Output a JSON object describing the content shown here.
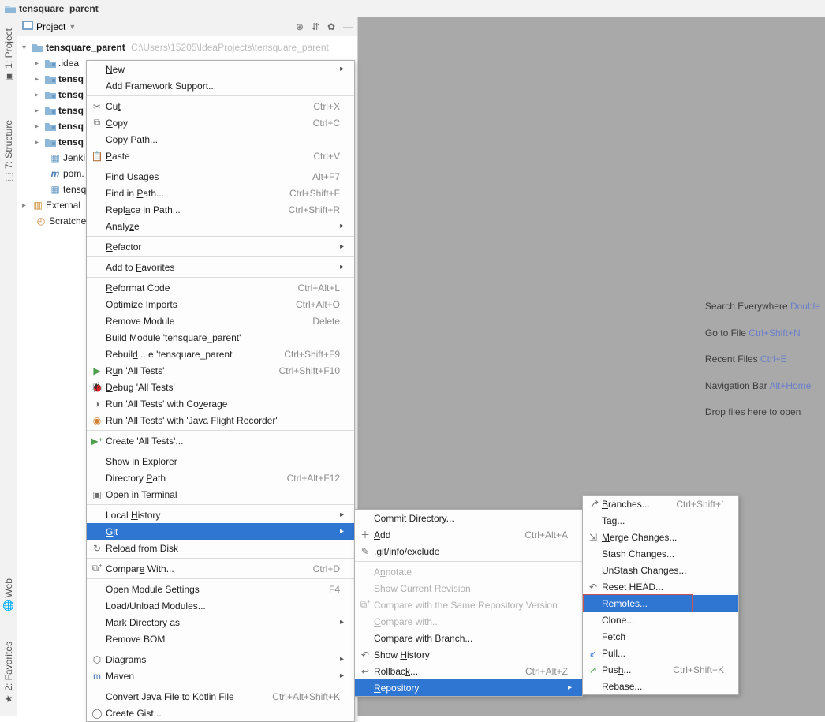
{
  "window": {
    "title": "tensquare_parent"
  },
  "leftTabs": {
    "project": "1: Project",
    "structure": "7: Structure",
    "web": "Web",
    "favorites": "2: Favorites"
  },
  "projectHeader": {
    "label": "Project",
    "icons": {
      "target": "⊕",
      "collapse": "⇵",
      "gear": "✿",
      "hide": "—"
    }
  },
  "tree": {
    "root": {
      "name": "tensquare_parent",
      "path": "C:\\Users\\15205\\IdeaProjects\\tensquare_parent"
    },
    "items": [
      {
        "name": ".idea"
      },
      {
        "name": "tensq"
      },
      {
        "name": "tensq"
      },
      {
        "name": "tensq"
      },
      {
        "name": "tensq"
      },
      {
        "name": "tensq"
      },
      {
        "name": "Jenki"
      },
      {
        "name": "pom."
      },
      {
        "name": "tensq"
      }
    ],
    "external": "External",
    "scratches": "Scratche"
  },
  "tips": [
    {
      "pre": "Search Everywhere ",
      "key": "Double"
    },
    {
      "pre": "Go to File ",
      "key": "Ctrl+Shift+N"
    },
    {
      "pre": "Recent Files ",
      "key": "Ctrl+E"
    },
    {
      "pre": "Navigation Bar ",
      "key": "Alt+Home"
    },
    {
      "pre": "Drop files here to open",
      "key": ""
    }
  ],
  "menu1": [
    {
      "type": "item",
      "u": "N",
      "label": "ew",
      "arrow": true
    },
    {
      "type": "item",
      "label": "Add Framework Support..."
    },
    {
      "type": "sep"
    },
    {
      "type": "item",
      "icon": "✂",
      "label": "Cu",
      "u": "t",
      "after": "",
      "sc": "Ctrl+X"
    },
    {
      "type": "item",
      "icon": "⧉",
      "u": "C",
      "label": "opy",
      "sc": "Ctrl+C"
    },
    {
      "type": "item",
      "label": "Copy Path..."
    },
    {
      "type": "item",
      "icon": "📋",
      "u": "P",
      "label": "aste",
      "sc": "Ctrl+V"
    },
    {
      "type": "sep"
    },
    {
      "type": "item",
      "label": "Find ",
      "u": "U",
      "after": "sages",
      "sc": "Alt+F7"
    },
    {
      "type": "item",
      "label": "Find in ",
      "u": "P",
      "after": "ath...",
      "sc": "Ctrl+Shift+F"
    },
    {
      "type": "item",
      "label": "Repl",
      "u": "a",
      "after": "ce in Path...",
      "sc": "Ctrl+Shift+R"
    },
    {
      "type": "item",
      "label": "Analy",
      "u": "z",
      "after": "e",
      "arrow": true
    },
    {
      "type": "sep"
    },
    {
      "type": "item",
      "u": "R",
      "label": "efactor",
      "arrow": true
    },
    {
      "type": "sep"
    },
    {
      "type": "item",
      "label": "Add to ",
      "u": "F",
      "after": "avorites",
      "arrow": true
    },
    {
      "type": "sep"
    },
    {
      "type": "item",
      "u": "R",
      "label": "eformat Code",
      "sc": "Ctrl+Alt+L"
    },
    {
      "type": "item",
      "label": "Optimi",
      "u": "z",
      "after": "e Imports",
      "sc": "Ctrl+Alt+O"
    },
    {
      "type": "item",
      "label": "Remove Module",
      "sc": "Delete"
    },
    {
      "type": "item",
      "label": "Build ",
      "u": "M",
      "after": "odule 'tensquare_parent'"
    },
    {
      "type": "item",
      "label": "Rebuil",
      "u": "d",
      "after": " ...e 'tensquare_parent'",
      "sc": "Ctrl+Shift+F9"
    },
    {
      "type": "item",
      "icon": "▶",
      "iconColor": "#4f9e4f",
      "label": "R",
      "u": "u",
      "after": "n 'All Tests'",
      "sc": "Ctrl+Shift+F10"
    },
    {
      "type": "item",
      "icon": "🐞",
      "iconColor": "#4f9e4f",
      "u": "D",
      "label": "ebug 'All Tests'"
    },
    {
      "type": "item",
      "icon": "◑",
      "label": "Run 'All Tests' with Co",
      "u": "v",
      "after": "erage"
    },
    {
      "type": "item",
      "icon": "◉",
      "iconColor": "#d08030",
      "label": "Run 'All Tests' with 'Java Flight Recorder'"
    },
    {
      "type": "sep"
    },
    {
      "type": "item",
      "icon": "▶⁺",
      "iconColor": "#4f9e4f",
      "label": "Create 'All Tests'..."
    },
    {
      "type": "sep"
    },
    {
      "type": "item",
      "label": "Show in Explorer"
    },
    {
      "type": "item",
      "label": "Directory ",
      "u": "P",
      "after": "ath",
      "sc": "Ctrl+Alt+F12"
    },
    {
      "type": "item",
      "icon": "▣",
      "label": "Open in Terminal"
    },
    {
      "type": "sep"
    },
    {
      "type": "item",
      "label": "Local ",
      "u": "H",
      "after": "istory",
      "arrow": true
    },
    {
      "type": "item",
      "selected": true,
      "u": "G",
      "label": "it",
      "arrow": true
    },
    {
      "type": "item",
      "icon": "↻",
      "label": "Reload from Disk"
    },
    {
      "type": "sep"
    },
    {
      "type": "item",
      "icon": "⧉⁺",
      "label": "Compar",
      "u": "e",
      "after": " With...",
      "sc": "Ctrl+D"
    },
    {
      "type": "sep"
    },
    {
      "type": "item",
      "label": "Open Module Settings",
      "sc": "F4"
    },
    {
      "type": "item",
      "label": "Load/Unload Modules..."
    },
    {
      "type": "item",
      "label": "Mark Directory as",
      "arrow": true
    },
    {
      "type": "item",
      "label": "Remove BOM"
    },
    {
      "type": "sep"
    },
    {
      "type": "item",
      "icon": "⬡",
      "label": "Diagrams",
      "arrow": true
    },
    {
      "type": "item",
      "icon": "m",
      "iconColor": "#4a7ab5",
      "label": "Maven",
      "arrow": true
    },
    {
      "type": "sep"
    },
    {
      "type": "item",
      "label": "Convert Java File to Kotlin File",
      "sc": "Ctrl+Alt+Shift+K"
    },
    {
      "type": "item",
      "icon": "◯",
      "label": "Create Gist..."
    }
  ],
  "menu2": [
    {
      "type": "item",
      "label": "Commit Directory..."
    },
    {
      "type": "item",
      "icon": "＋",
      "u": "A",
      "label": "dd",
      "sc": "Ctrl+Alt+A"
    },
    {
      "type": "item",
      "icon": "✎",
      "label": ".git/info/exclude"
    },
    {
      "type": "sep"
    },
    {
      "type": "item",
      "disabled": true,
      "label": "A",
      "u": "n",
      "after": "notate"
    },
    {
      "type": "item",
      "disabled": true,
      "label": "Show Current Revision"
    },
    {
      "type": "item",
      "disabled": true,
      "icon": "⧉⁺",
      "label": "Compare with the Same Repository Version"
    },
    {
      "type": "item",
      "disabled": true,
      "u": "C",
      "label": "ompare with..."
    },
    {
      "type": "item",
      "label": "Compare with Branch..."
    },
    {
      "type": "item",
      "icon": "↶",
      "label": "Show ",
      "u": "H",
      "after": "istory"
    },
    {
      "type": "item",
      "icon": "↩",
      "label": "Rollbac",
      "u": "k",
      "after": "...",
      "sc": "Ctrl+Alt+Z"
    },
    {
      "type": "item",
      "selected": true,
      "u": "R",
      "label": "epository",
      "arrow": true
    }
  ],
  "menu3": [
    {
      "type": "item",
      "icon": "⎇",
      "u": "B",
      "label": "ranches...",
      "sc": "Ctrl+Shift+`"
    },
    {
      "type": "item",
      "label": "Tag..."
    },
    {
      "type": "item",
      "icon": "⇲",
      "u": "M",
      "label": "erge Changes..."
    },
    {
      "type": "item",
      "label": "Stash Changes..."
    },
    {
      "type": "item",
      "label": "UnStash Changes..."
    },
    {
      "type": "item",
      "icon": "↶",
      "label": "Reset HEAD..."
    },
    {
      "type": "item",
      "selected": true,
      "label": "Remotes...",
      "highlight": true
    },
    {
      "type": "item",
      "label": "Clone..."
    },
    {
      "type": "item",
      "label": "Fetch"
    },
    {
      "type": "item",
      "icon": "↙",
      "iconColor": "#3a7fd4",
      "label": "Pull..."
    },
    {
      "type": "item",
      "icon": "↗",
      "iconColor": "#3f9e3f",
      "label": "Pus",
      "u": "h",
      "after": "...",
      "sc": "Ctrl+Shift+K"
    },
    {
      "type": "item",
      "label": "Rebase..."
    }
  ]
}
